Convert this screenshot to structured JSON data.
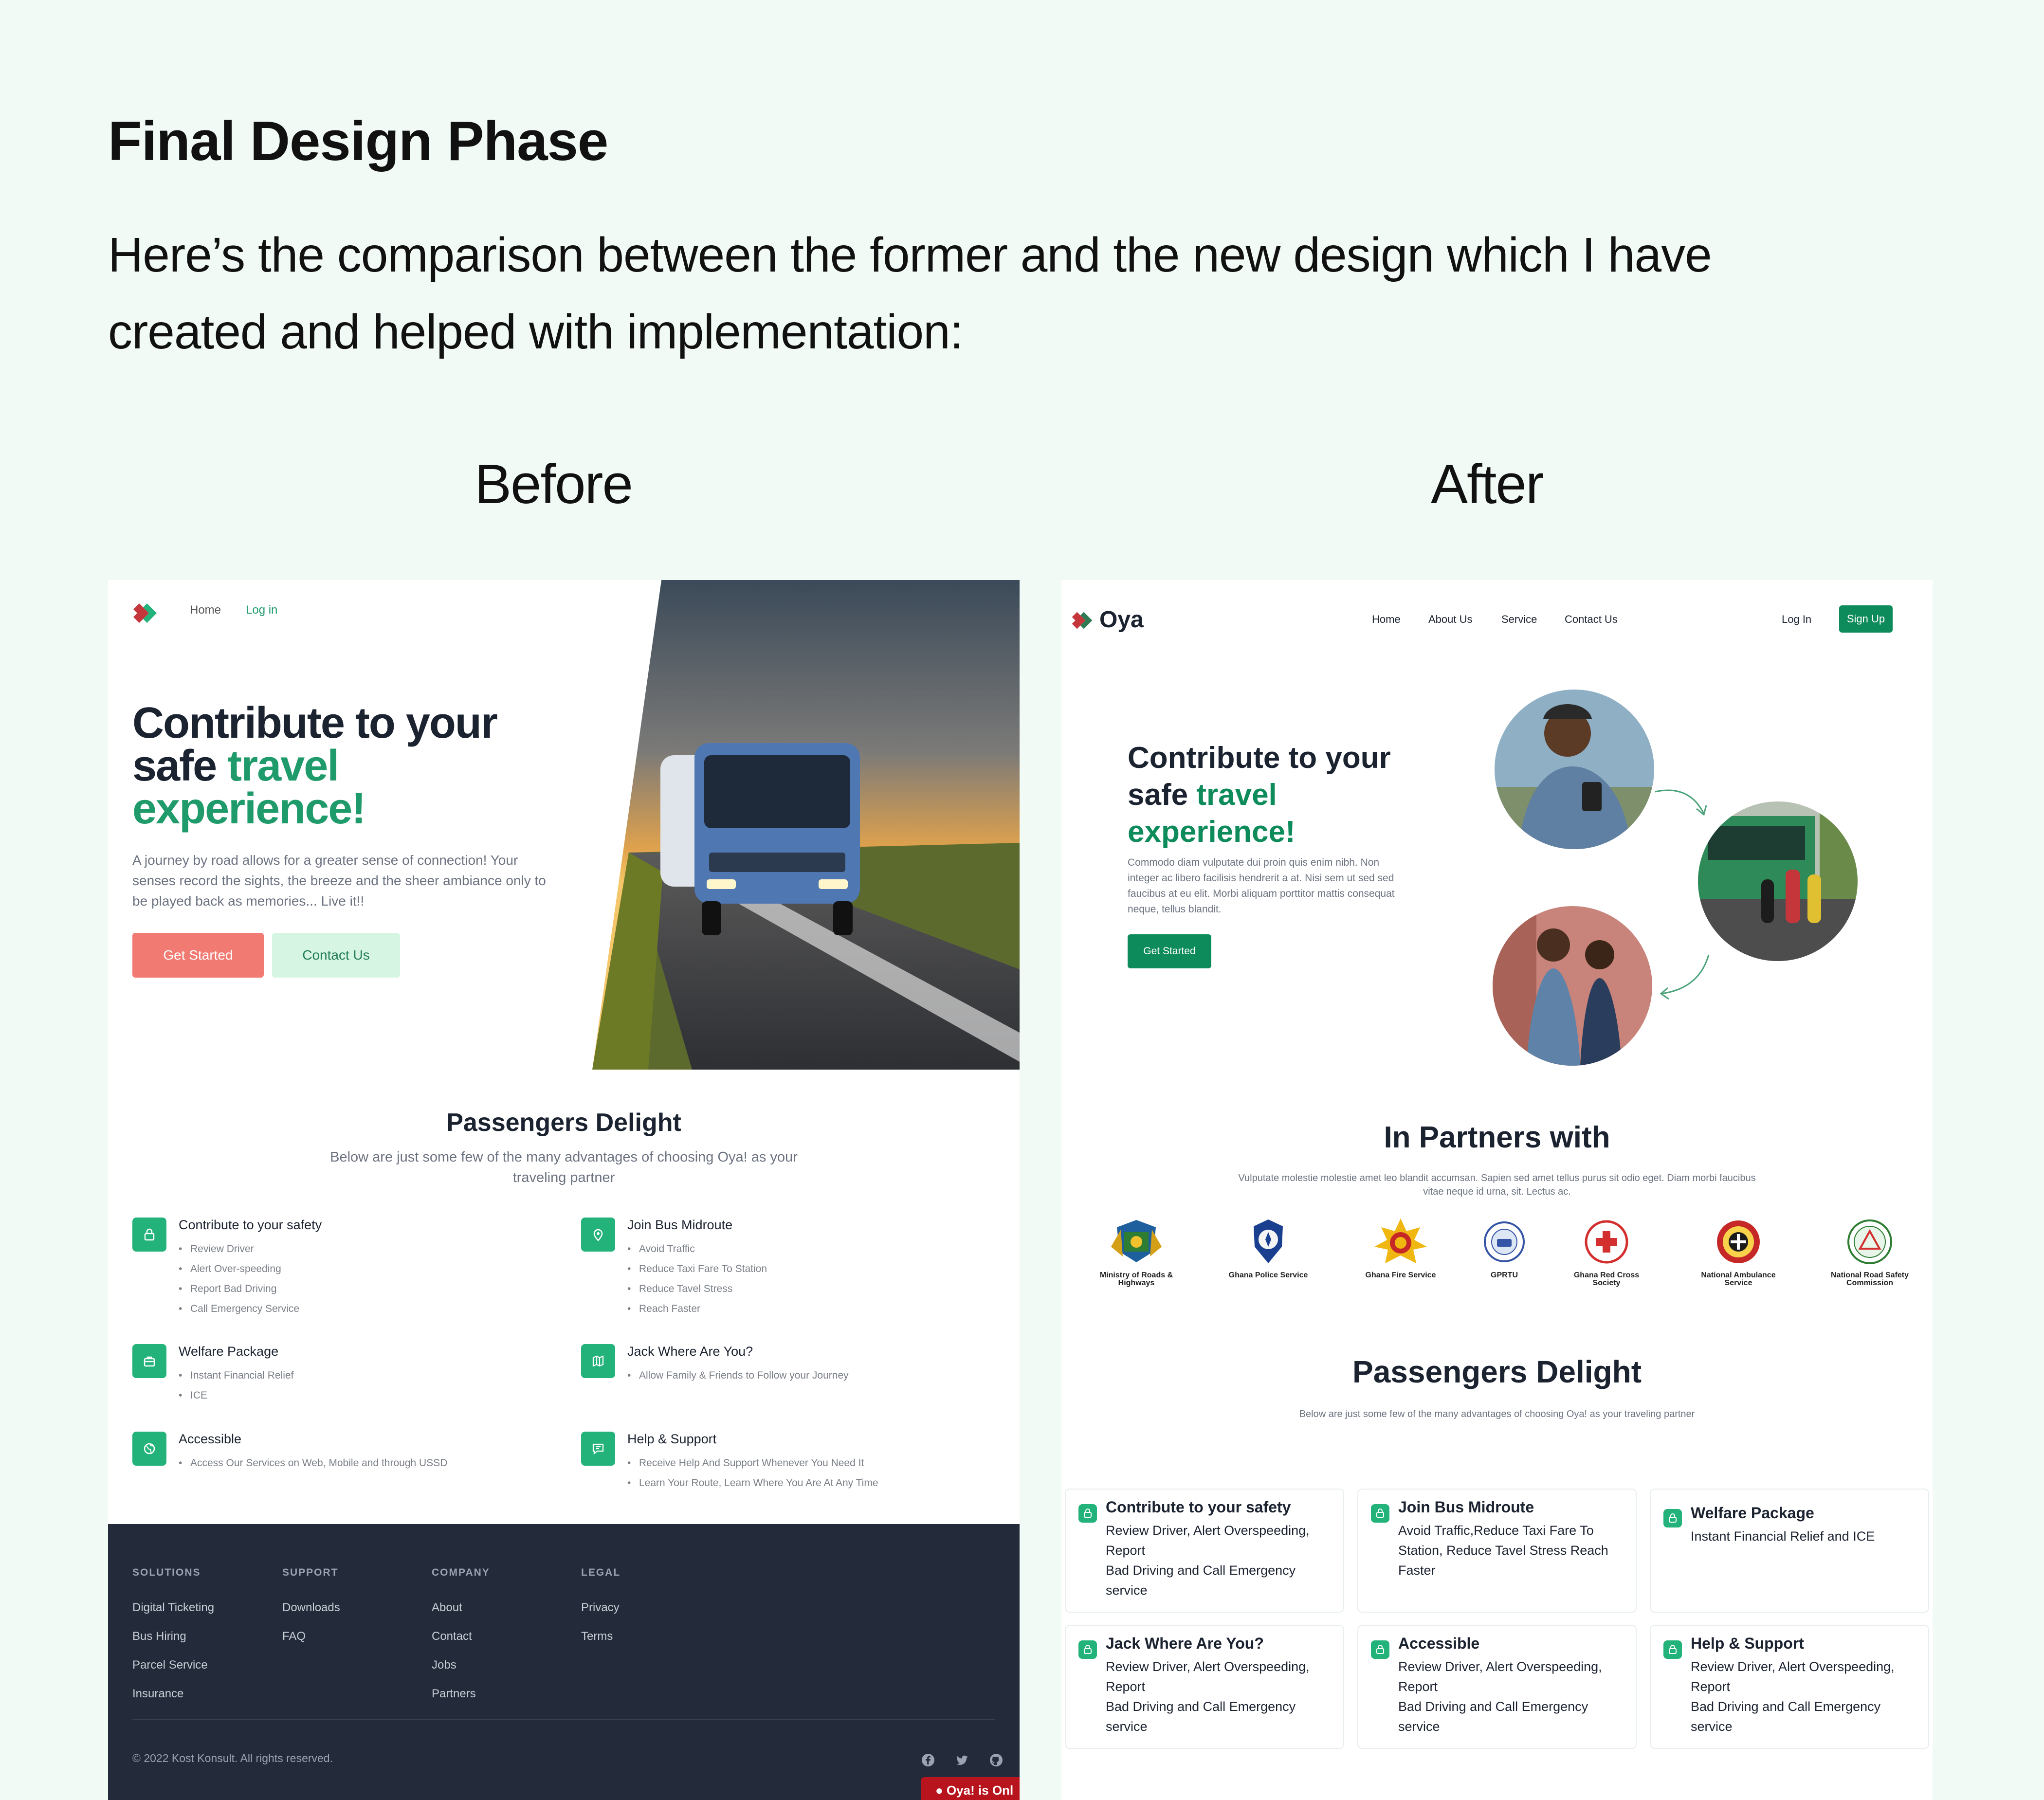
{
  "heading": "Final Design Phase",
  "subheading": "Here’s the comparison between the former and the new design which I have created and helped with implementation:",
  "before_label": "Before",
  "after_label": "After",
  "colors": {
    "background": "#f1faf5",
    "brand_green": "#0e8b5b",
    "coral": "#f17a72",
    "footer_dark": "#232b3a"
  },
  "before": {
    "nav": [
      "Home",
      "Log in"
    ],
    "hero": {
      "title_1": "Contribute to your",
      "title_2": "safe",
      "title_accent": "travel",
      "title_3": "experience!",
      "description": "A journey by road allows for a greater sense of connection! Your senses record the sights, the breeze and the sheer ambiance only to be played back as memories... Live it!!",
      "primary_button": "Get Started",
      "secondary_button": "Contact Us"
    },
    "section": {
      "title": "Passengers Delight",
      "subtitle": "Below are just some few of the many advantages of choosing Oya! as your traveling partner"
    },
    "features": [
      {
        "icon": "lock-icon",
        "title": "Contribute to your safety",
        "items": [
          "Review Driver",
          "Alert Over-speeding",
          "Report Bad Driving",
          "Call Emergency Service"
        ]
      },
      {
        "icon": "location-icon",
        "title": "Join Bus Midroute",
        "items": [
          "Avoid Traffic",
          "Reduce Taxi Fare To Station",
          "Reduce Tavel Stress",
          "Reach Faster"
        ]
      },
      {
        "icon": "briefcase-icon",
        "title": "Welfare Package",
        "items": [
          "Instant Financial Relief",
          "ICE"
        ]
      },
      {
        "icon": "map-icon",
        "title": "Jack Where Are You?",
        "items": [
          "Allow Family & Friends to Follow your Journey"
        ]
      },
      {
        "icon": "globe-icon",
        "title": "Accessible",
        "items": [
          "Access Our Services on Web, Mobile and through USSD"
        ]
      },
      {
        "icon": "chat-icon",
        "title": "Help & Support",
        "items": [
          "Receive Help And Support Whenever You Need It",
          "Learn Your Route, Learn Where You Are At Any Time"
        ]
      }
    ],
    "footer": {
      "columns": [
        {
          "heading": "SOLUTIONS",
          "links": [
            "Digital Ticketing",
            "Bus Hiring",
            "Parcel Service",
            "Insurance"
          ]
        },
        {
          "heading": "SUPPORT",
          "links": [
            "Downloads",
            "FAQ"
          ]
        },
        {
          "heading": "COMPANY",
          "links": [
            "About",
            "Contact",
            "Jobs",
            "Partners"
          ]
        },
        {
          "heading": "LEGAL",
          "links": [
            "Privacy",
            "Terms"
          ]
        }
      ],
      "copyright": "© 2022 Kost Konsult. All rights reserved.",
      "social_icons": [
        "facebook-icon",
        "twitter-icon",
        "github-icon"
      ],
      "status_toast": "Oya! is Onl"
    }
  },
  "after": {
    "brand": "Oya",
    "nav": [
      "Home",
      "About Us",
      "Service",
      "Contact Us"
    ],
    "login": "Log In",
    "signup": "Sign Up",
    "hero": {
      "title_1": "Contribute to your",
      "title_2": "safe",
      "title_accent": "travel",
      "title_3": "experience!",
      "description": "Commodo diam vulputate dui proin quis enim nibh. Non integer ac libero facilisis hendrerit a at. Nisi sem ut sed sed faucibus at eu elit. Morbi aliquam porttitor mattis consequat neque, tellus blandit.",
      "button": "Get Started"
    },
    "partners": {
      "title": "In Partners with",
      "subtitle": "Vulputate molestie molestie amet leo blandit accumsan. Sapien sed amet tellus purus sit odio eget. Diam morbi faucibus vitae neque id urna, sit. Lectus ac.",
      "items": [
        {
          "name": "Ministry of Roads & Highways",
          "icon": "coat-of-arms-icon"
        },
        {
          "name": "Ghana Police Service",
          "icon": "police-badge-icon"
        },
        {
          "name": "Ghana Fire Service",
          "icon": "fire-service-badge-icon"
        },
        {
          "name": "GPRTU",
          "icon": "gprtu-logo-icon"
        },
        {
          "name": "Ghana Red Cross Society",
          "icon": "red-cross-icon"
        },
        {
          "name": "National Ambulance Service",
          "icon": "ambulance-badge-icon"
        },
        {
          "name": "National Road Safety Commission",
          "icon": "road-safety-badge-icon"
        }
      ]
    },
    "section": {
      "title": "Passengers Delight",
      "subtitle": "Below are just some few of the many advantages of choosing Oya! as your traveling partner"
    },
    "cards": [
      {
        "title": "Contribute to your safety",
        "lines": [
          "Review Driver, Alert Overspeeding, Report",
          "Bad Driving and Call Emergency service"
        ]
      },
      {
        "title": "Join Bus Midroute",
        "lines": [
          "Avoid Traffic,Reduce Taxi Fare To Station, Reduce Tavel Stress Reach Faster"
        ]
      },
      {
        "title": "Welfare Package",
        "lines": [
          "Instant Financial Relief and ICE"
        ]
      },
      {
        "title": "Jack Where Are You?",
        "lines": [
          "Review Driver, Alert Overspeeding, Report",
          "Bad Driving and Call Emergency service"
        ]
      },
      {
        "title": "Accessible",
        "lines": [
          "Review Driver, Alert Overspeeding, Report",
          "Bad Driving and Call Emergency service"
        ]
      },
      {
        "title": "Help & Support",
        "lines": [
          "Review Driver, Alert Overspeeding, Report",
          "Bad Driving and Call Emergency service"
        ]
      }
    ]
  }
}
